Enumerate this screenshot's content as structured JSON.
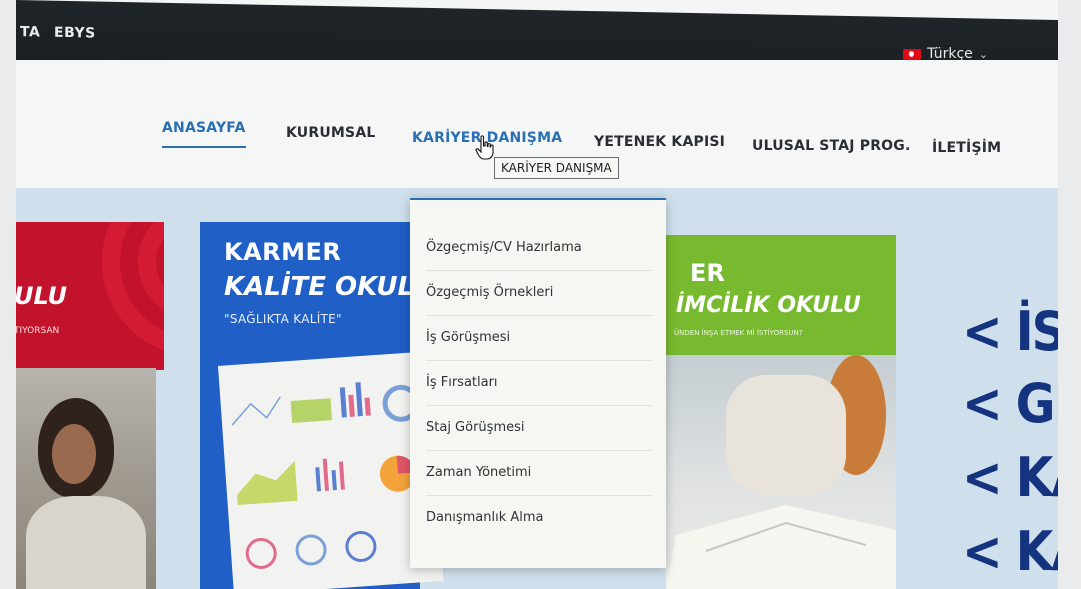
{
  "topbar": {
    "left_items": [
      "TA",
      "EBYS"
    ],
    "language_label": "Türkçe"
  },
  "nav": {
    "items": [
      "ANASAYFA",
      "KURUMSAL",
      "KARİYER DANIŞMA",
      "YETENEK KAPISI",
      "ULUSAL STAJ PROG.",
      "İLETİŞİM"
    ],
    "tooltip": "KARİYER DANIŞMA"
  },
  "dropdown": {
    "items": [
      "Özgeçmiş/CV Hazırlama",
      "Özgeçmiş Örnekleri",
      "İş Görüşmesi",
      "İş Fırsatları",
      "Staj Görüşmesi",
      "Zaman Yönetimi",
      "Danışmanlık Alma"
    ]
  },
  "cards": {
    "red": {
      "title": "ULU",
      "subtitle": "TIYORSAN"
    },
    "blue": {
      "title": "KARMER",
      "title2": "KALİTE OKULU",
      "tagline": "\"SAĞLIKTA KALİTE\""
    },
    "green": {
      "title": "ER",
      "title2": "İMCİLİK OKULU",
      "tagline": "ÜNDEN İNŞA ETMEK Mİ İSTİYORSUN?"
    }
  },
  "right_banner": [
    "< İST",
    "< GİF",
    "< KA",
    "< KA"
  ],
  "colors": {
    "accent": "#2b6fb3",
    "topbar": "#1f2428",
    "blue_card": "#1f5fc6",
    "green_card": "#78ba2f",
    "red_card": "#c3122b",
    "banner_text": "#15347f"
  }
}
